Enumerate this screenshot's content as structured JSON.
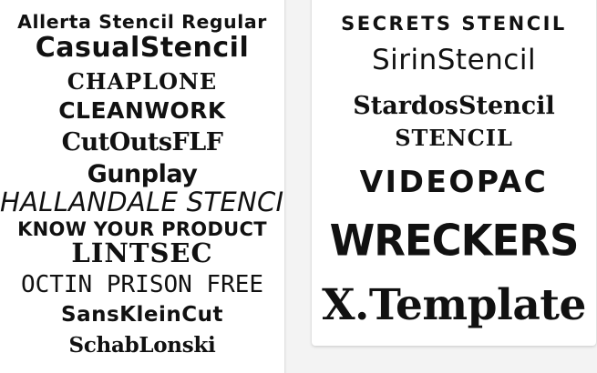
{
  "left_card": {
    "fonts": [
      "Allerta Stencil Regular",
      "CasualStencil",
      "CHAPLONE",
      "CLEANWORK",
      "CutOutsFLF",
      "Gunplay",
      "HALLANDALE STENCIL",
      "KNOW YOUR PRODUCT",
      "LINTSEC",
      "OCTIN PRISON FREE",
      "SansKleinCut",
      "SchabLonski"
    ]
  },
  "right_card": {
    "fonts": [
      "SECRETS STENCIL",
      "SirinStencil",
      "StardosStencil",
      "STENCIL",
      "VIDEOPAC",
      "WRECKERS",
      "X.Template"
    ]
  }
}
